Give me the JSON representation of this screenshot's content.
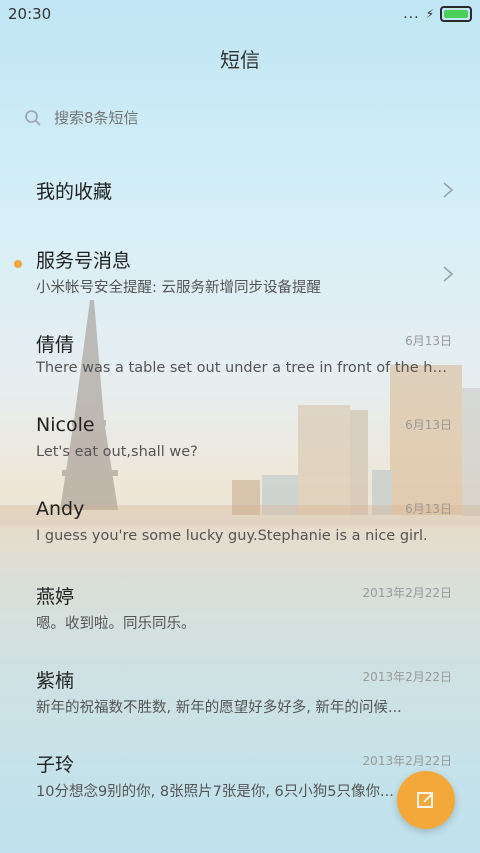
{
  "statusbar": {
    "time": "20:30",
    "dots": "...",
    "bolt": "⚡"
  },
  "header": {
    "title": "短信"
  },
  "search": {
    "placeholder": "搜索8条短信"
  },
  "favorites": {
    "label": "我的收藏"
  },
  "conversations": [
    {
      "name": "服务号消息",
      "preview": "小米帐号安全提醒: 云服务新增同步设备提醒",
      "date": "",
      "unread": true
    },
    {
      "name": "倩倩",
      "preview": "There was a table set out under a tree in front of the ho...",
      "date": "6月13日"
    },
    {
      "name": "Nicole",
      "preview": "Let's eat out,shall we?",
      "date": "6月13日"
    },
    {
      "name": "Andy",
      "preview": "I guess you're some lucky guy.Stephanie is a nice girl.",
      "date": "6月13日"
    },
    {
      "name": "燕婷",
      "preview": "嗯。收到啦。同乐同乐。",
      "date": "2013年2月22日"
    },
    {
      "name": "紫楠",
      "preview": "新年的祝福数不胜数, 新年的愿望好多好多, 新年的问候...",
      "date": "2013年2月22日"
    },
    {
      "name": "子玲",
      "preview": "10分想念9别的你, 8张照片7张是你, 6只小狗5只像你...",
      "date": "2013年2月22日"
    }
  ],
  "colors": {
    "accent": "#f4a83a",
    "unread": "#f2a33a",
    "battery": "#4cd05a"
  }
}
